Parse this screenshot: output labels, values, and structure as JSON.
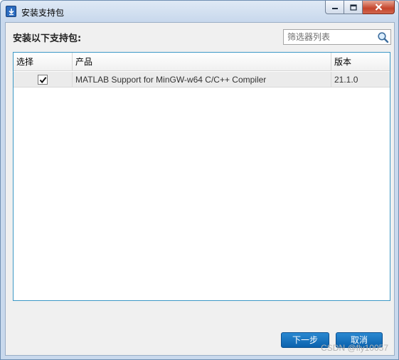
{
  "window": {
    "title": "安装支持包",
    "app_icon": "download-app-icon"
  },
  "header": {
    "label": "安装以下支持包:"
  },
  "filter": {
    "placeholder": "筛选器列表",
    "icon": "search-icon"
  },
  "table": {
    "columns": [
      "选择",
      "产品",
      "版本"
    ],
    "rows": [
      {
        "selected": true,
        "product": "MATLAB Support for MinGW-w64 C/C++ Compiler",
        "version": "21.1.0"
      }
    ]
  },
  "buttons": {
    "next": "下一步",
    "cancel": "取消"
  },
  "watermark": "CSDN @fly10057"
}
